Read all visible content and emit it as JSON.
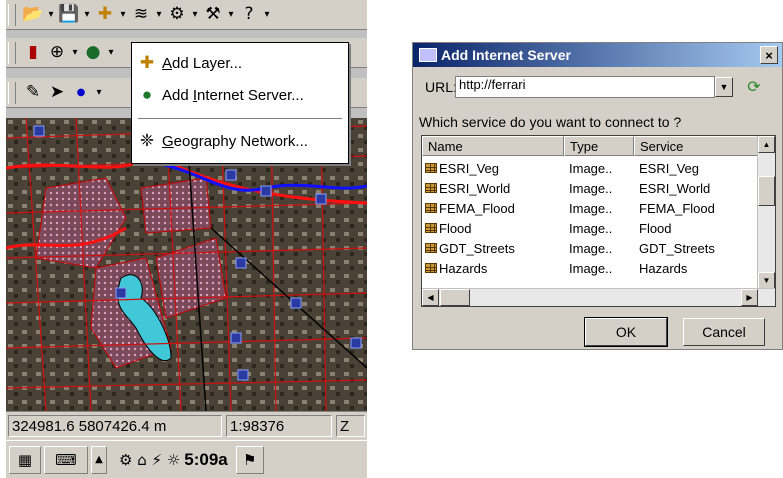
{
  "ppc": {
    "toolbar1": {
      "icons": [
        "open-icon",
        "save-icon",
        "add-data-icon",
        "layers-icon",
        "identify-tool-icon",
        "tools-icon",
        "help-icon"
      ]
    },
    "toolbar2": {
      "icons": [
        "legend-icon",
        "zoom-in-icon",
        "globe-icon"
      ]
    },
    "toolbar3": {
      "icons": [
        "pen-icon",
        "pointer-icon",
        "point-icon"
      ]
    },
    "menu": {
      "items": [
        {
          "prefix": "",
          "accel": "A",
          "rest": "dd Layer..."
        },
        {
          "prefix": "Add ",
          "accel": "I",
          "rest": "nternet Server..."
        },
        {
          "prefix": "",
          "accel": "G",
          "rest": "eography Network..."
        }
      ]
    },
    "status": {
      "coords": "324981.6 5807426.4",
      "units": "m",
      "scale": "1:98376",
      "z": "Z"
    },
    "taskbar": {
      "time": "5:09a"
    }
  },
  "dialog": {
    "title": "Add Internet Server",
    "close_label": "×",
    "url_label": "URL:",
    "url_value": "http://ferrari",
    "question": "Which service do you want to connect to ?",
    "columns": [
      "Name",
      "Type",
      "Service"
    ],
    "rows": [
      {
        "name": "ESRI_Veg",
        "type": "Image..",
        "service": "ESRI_Veg"
      },
      {
        "name": "ESRI_World",
        "type": "Image..",
        "service": "ESRI_World"
      },
      {
        "name": "FEMA_Flood",
        "type": "Image..",
        "service": "FEMA_Flood"
      },
      {
        "name": "Flood",
        "type": "Image..",
        "service": "Flood"
      },
      {
        "name": "GDT_Streets",
        "type": "Image..",
        "service": "GDT_Streets"
      },
      {
        "name": "Hazards",
        "type": "Image..",
        "service": "Hazards"
      }
    ],
    "ok_label": "OK",
    "cancel_label": "Cancel"
  }
}
